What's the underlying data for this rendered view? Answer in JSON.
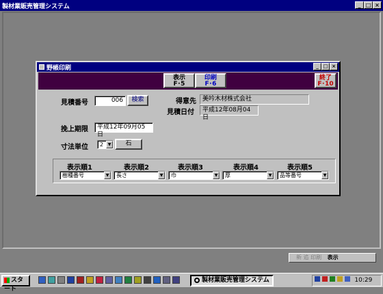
{
  "window": {
    "title": "製材業販売管理システム",
    "min": "_",
    "max": "□",
    "close": "×"
  },
  "dialog": {
    "title": "野帳印刷",
    "buttons": {
      "min": "_",
      "max": "□",
      "close": "×"
    },
    "toolbar": {
      "display": {
        "line1": "表示",
        "line2": "F･5"
      },
      "print": {
        "line1": "印刷",
        "line2": "F･6"
      },
      "exit": {
        "line1": "終了",
        "line2": "F･10"
      }
    },
    "estimate_no": {
      "label": "見積番号",
      "value": "006",
      "search": "検索"
    },
    "client": {
      "label": "得意先",
      "value": "美吟木材株式会社"
    },
    "estimate_date": {
      "label": "見積日付",
      "value": "平成12年08月04日"
    },
    "deadline": {
      "label": "挽上期限",
      "value": "平成12年09月05日"
    },
    "unit": {
      "label": "寸法単位",
      "value": "2",
      "unit_name": "石"
    },
    "sort_orders": [
      {
        "label": "表示順1",
        "value": "樹種番号"
      },
      {
        "label": "表示順2",
        "value": "長さ"
      },
      {
        "label": "表示順3",
        "value": "巾"
      },
      {
        "label": "表示順4",
        "value": "厚"
      },
      {
        "label": "表示順5",
        "value": "品等番号"
      }
    ]
  },
  "navbar": {
    "text": "新 追 印刷",
    "label": "表示"
  },
  "taskbar": {
    "start": "スタート",
    "task": "製材業販売管理システム",
    "clock": "10:29"
  }
}
